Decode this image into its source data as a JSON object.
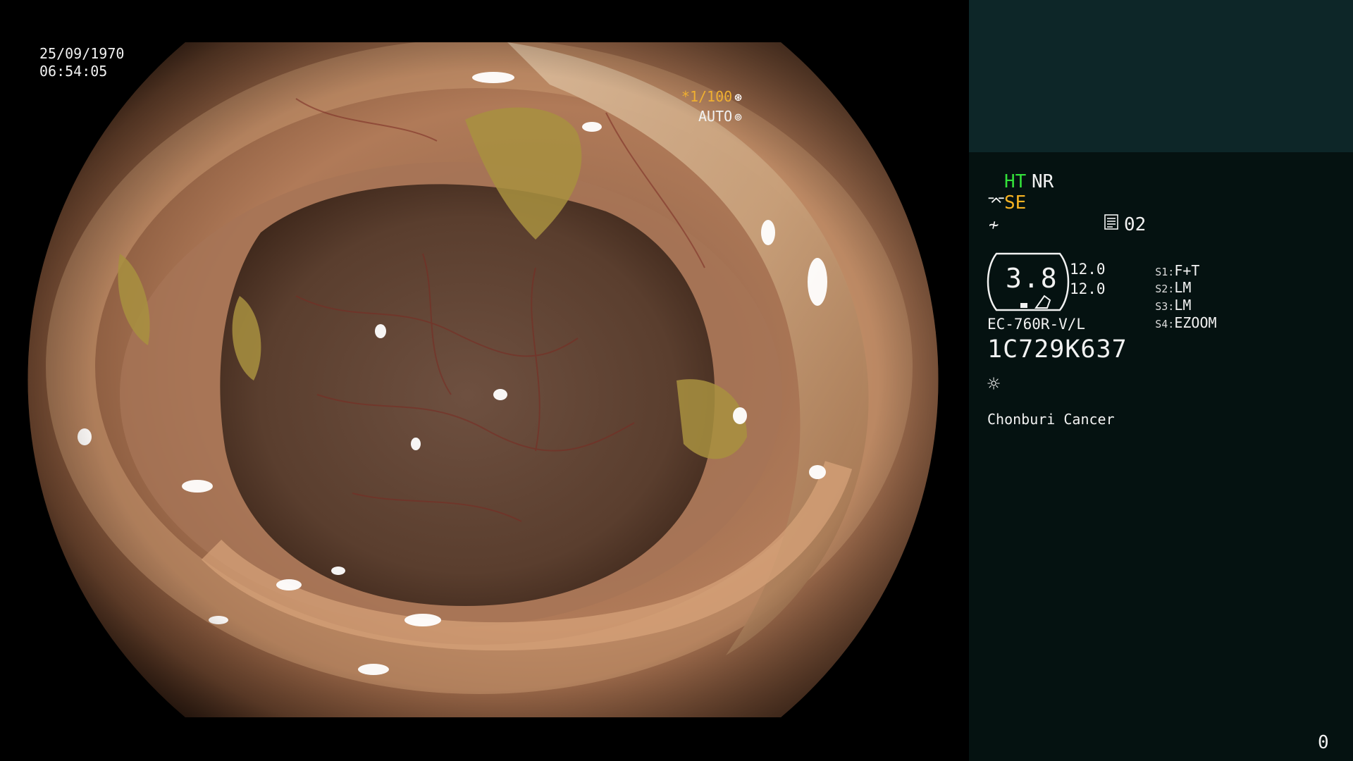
{
  "overlay": {
    "date": "25/09/1970",
    "time": "06:54:05",
    "shutter": "*1/100",
    "shutter_icon": "shutter-icon",
    "iris": "AUTO",
    "iris_icon": "iris-icon"
  },
  "panel": {
    "ht": "HT",
    "nr": "NR",
    "se": "SE",
    "se_icon": "structure-enhance-icon",
    "sharp_icon": "sharpness-icon",
    "doc_icon": "document-icon",
    "doc_value": "02",
    "gauge_value": "3.8",
    "gauge_values": [
      "12.0",
      "12.0"
    ],
    "switches": [
      {
        "key": "S1:",
        "value": "F+T"
      },
      {
        "key": "S2:",
        "value": "LM"
      },
      {
        "key": "S3:",
        "value": "LM"
      },
      {
        "key": "S4:",
        "value": "EZOOM"
      }
    ],
    "model": "EC-760R-V/L",
    "serial": "1C729K637",
    "light_icon": "light-source-icon",
    "site": "Chonburi Cancer",
    "counter": "0"
  },
  "colors": {
    "ht": "#33e03a",
    "se": "#f7b322",
    "shutter": "#f0b030",
    "panel_bg": "#051211",
    "panel_top_bg": "#0d2628"
  }
}
